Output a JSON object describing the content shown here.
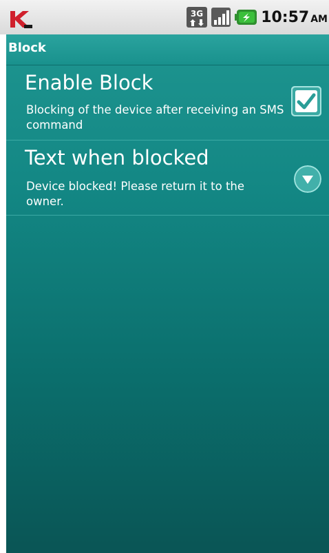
{
  "status_bar": {
    "network": "3G",
    "time": "10:57",
    "ampm": "AM"
  },
  "screen": {
    "title": "Block"
  },
  "preferences": [
    {
      "title": "Enable Block",
      "summary": "Blocking of the device after receiving an SMS command",
      "checked": true
    },
    {
      "title": "Text when blocked",
      "summary": "Device blocked! Please return it to the owner."
    }
  ],
  "colors": {
    "accent": "#19918d",
    "background_top": "#1e9590",
    "background_bottom": "#0a5555",
    "brand_red": "#d0202c"
  },
  "icons": {
    "app_logo": "kaspersky-logo-icon",
    "network": "network-3g-icon",
    "signal": "signal-strength-icon",
    "battery": "battery-charging-icon",
    "checkbox": "checkbox-checked-icon",
    "dropdown": "dropdown-arrow-icon"
  }
}
